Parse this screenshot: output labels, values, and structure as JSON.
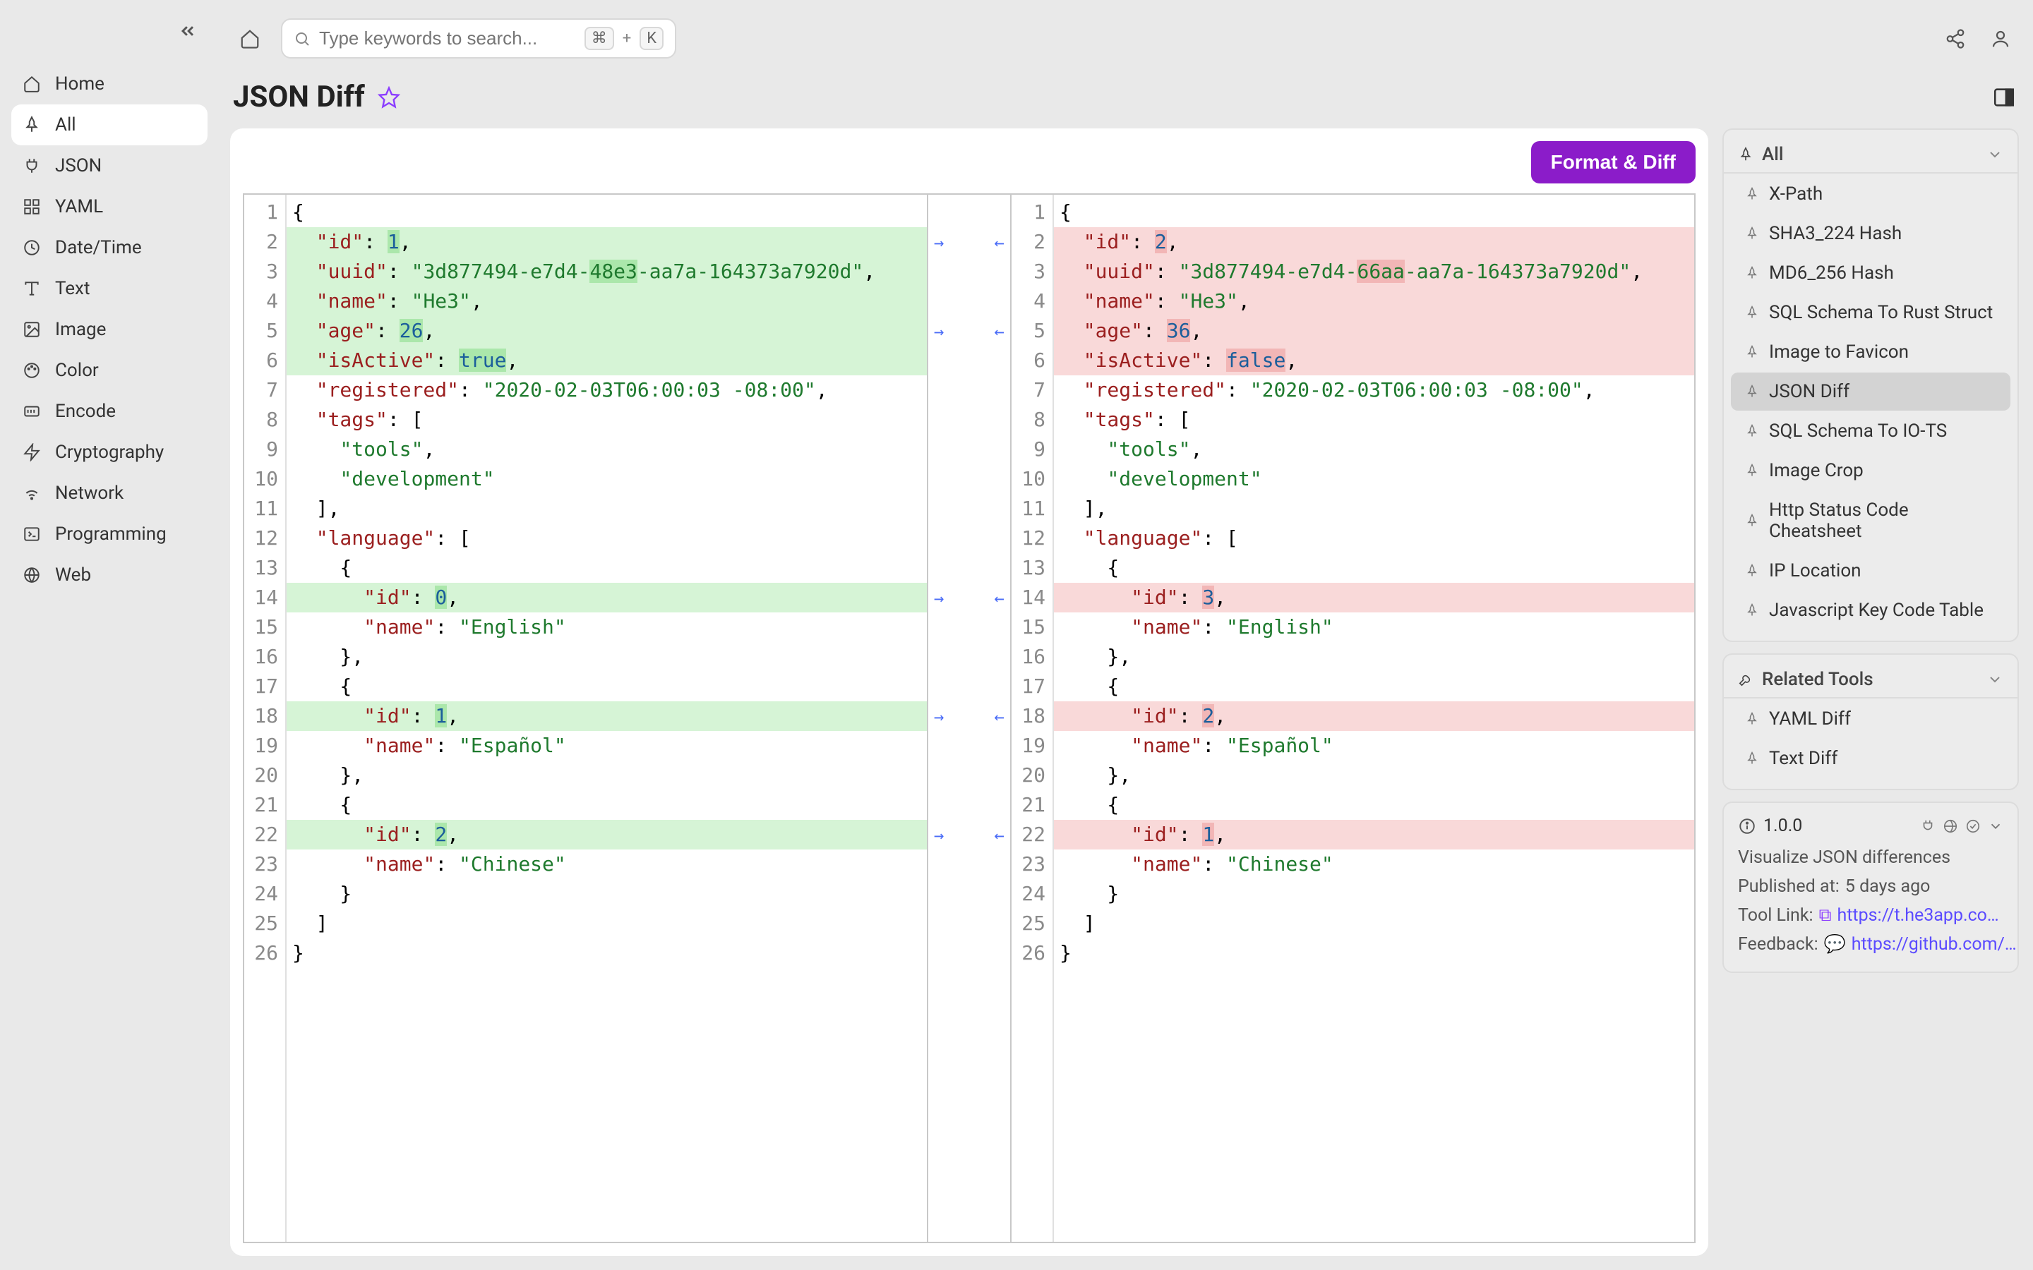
{
  "search": {
    "placeholder": "Type keywords to search...",
    "shortcut": {
      "mod": "⌘",
      "plus": "+",
      "key": "K"
    }
  },
  "sidebar": {
    "items": [
      {
        "label": "Home"
      },
      {
        "label": "All"
      },
      {
        "label": "JSON"
      },
      {
        "label": "YAML"
      },
      {
        "label": "Date/Time"
      },
      {
        "label": "Text"
      },
      {
        "label": "Image"
      },
      {
        "label": "Color"
      },
      {
        "label": "Encode"
      },
      {
        "label": "Cryptography"
      },
      {
        "label": "Network"
      },
      {
        "label": "Programming"
      },
      {
        "label": "Web"
      }
    ]
  },
  "title": "JSON Diff",
  "action_button": "Format & Diff",
  "right": {
    "all_header": "All",
    "items": [
      {
        "label": "X-Path"
      },
      {
        "label": "SHA3_224 Hash"
      },
      {
        "label": "MD6_256 Hash"
      },
      {
        "label": "SQL Schema To Rust Struct"
      },
      {
        "label": "Image to Favicon"
      },
      {
        "label": "JSON Diff"
      },
      {
        "label": "SQL Schema To IO-TS"
      },
      {
        "label": "Image Crop"
      },
      {
        "label": "Http Status Code Cheatsheet"
      },
      {
        "label": "IP Location"
      },
      {
        "label": "Javascript Key Code Table"
      }
    ],
    "related_header": "Related Tools",
    "related": [
      {
        "label": "YAML Diff"
      },
      {
        "label": "Text Diff"
      }
    ]
  },
  "meta": {
    "version": "1.0.0",
    "desc": "Visualize JSON differences",
    "published_label": "Published at:",
    "published_value": "5 days ago",
    "tool_link_label": "Tool Link:",
    "tool_link_value": "https://t.he3app.co…",
    "feedback_label": "Feedback:",
    "feedback_value": "https://github.com/…"
  },
  "arrows": {
    "r": "→",
    "l": "←"
  },
  "diff": {
    "left_lines": 26,
    "right_lines": 26,
    "left": {
      "l2_id": "1",
      "l3_pre": "3d877494-e7d4-",
      "l3_mark": "48e3",
      "l3_post": "-aa7a-164373a7920d",
      "l4_name": "He3",
      "l5_age": "26",
      "l6_active": "true",
      "l7_reg": "2020-02-03T06:00:03 -08:00",
      "l9_tool": "tools",
      "l10_dev": "development",
      "l14_id": "0",
      "l15_name": "English",
      "l18_id": "1",
      "l19_name": "Español",
      "l22_id": "2",
      "l23_name": "Chinese"
    },
    "right": {
      "l2_id": "2",
      "l3_pre": "3d877494-e7d4-",
      "l3_mark": "66aa",
      "l3_post": "-aa7a-164373a7920d",
      "l4_name": "He3",
      "l5_age": "36",
      "l6_active": "false",
      "l7_reg": "2020-02-03T06:00:03 -08:00",
      "l9_tool": "tools",
      "l10_dev": "development",
      "l14_id": "3",
      "l15_name": "English",
      "l18_id": "2",
      "l19_name": "Español",
      "l22_id": "1",
      "l23_name": "Chinese"
    }
  }
}
